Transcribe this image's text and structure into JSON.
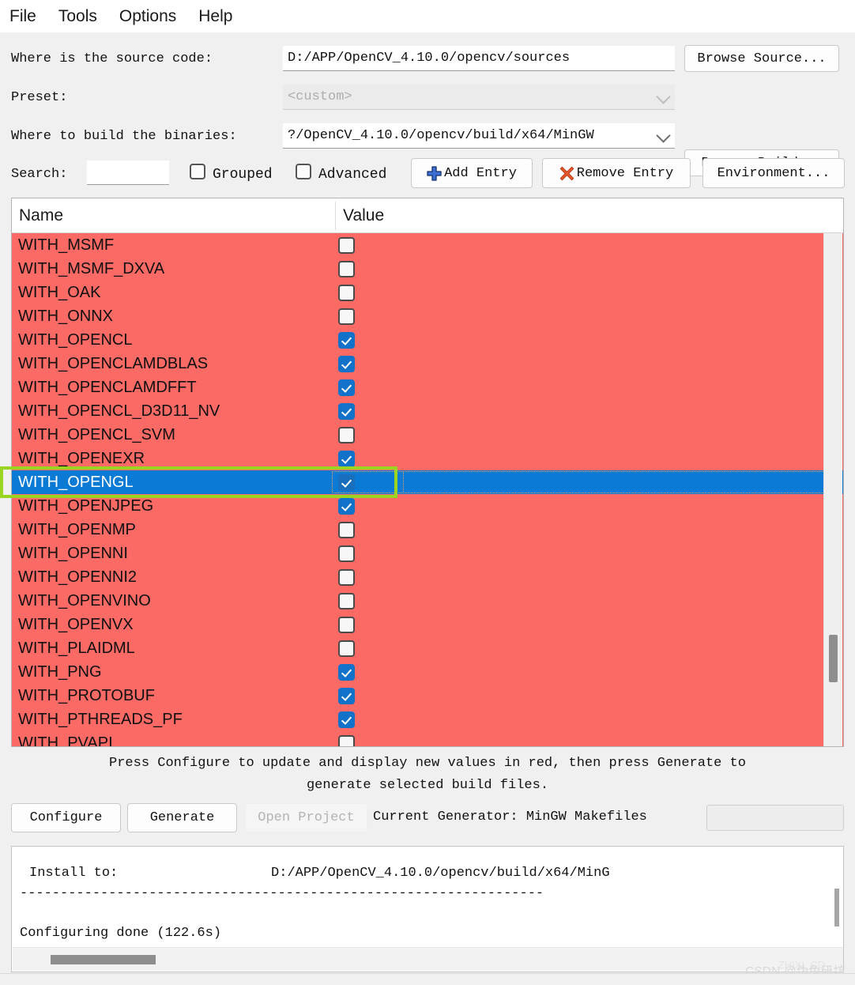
{
  "menubar": {
    "items": [
      {
        "label": "File"
      },
      {
        "label": "Tools"
      },
      {
        "label": "Options"
      },
      {
        "label": "Help"
      }
    ]
  },
  "form": {
    "source_label": "Where is the source code:",
    "source_value": "D:/APP/OpenCV_4.10.0/opencv/sources",
    "browse_source_label": "Browse Source...",
    "preset_label": "Preset:",
    "preset_value": "<custom>",
    "build_label": "Where to build the binaries:",
    "build_value": "?/OpenCV_4.10.0/opencv/build/x64/MinGW",
    "browse_build_label": "Browse Build..."
  },
  "toolbar": {
    "search_label": "Search:",
    "search_value": "",
    "search_placeholder": "",
    "grouped_label": "Grouped",
    "grouped_checked": false,
    "advanced_label": "Advanced",
    "advanced_checked": false,
    "add_entry_label": "Add Entry",
    "remove_entry_label": "Remove Entry",
    "environment_label": "Environment..."
  },
  "table": {
    "columns": [
      "Name",
      "Value"
    ],
    "row_background_color": "#fb6a65",
    "selection_color": "#0b7ad4",
    "highlight_box_color": "#9ad522",
    "rows": [
      {
        "name": "WITH_MSMF",
        "checked": false,
        "selected": false
      },
      {
        "name": "WITH_MSMF_DXVA",
        "checked": false,
        "selected": false
      },
      {
        "name": "WITH_OAK",
        "checked": false,
        "selected": false
      },
      {
        "name": "WITH_ONNX",
        "checked": false,
        "selected": false
      },
      {
        "name": "WITH_OPENCL",
        "checked": true,
        "selected": false
      },
      {
        "name": "WITH_OPENCLAMDBLAS",
        "checked": true,
        "selected": false
      },
      {
        "name": "WITH_OPENCLAMDFFT",
        "checked": true,
        "selected": false
      },
      {
        "name": "WITH_OPENCL_D3D11_NV",
        "checked": true,
        "selected": false
      },
      {
        "name": "WITH_OPENCL_SVM",
        "checked": false,
        "selected": false
      },
      {
        "name": "WITH_OPENEXR",
        "checked": true,
        "selected": false
      },
      {
        "name": "WITH_OPENGL",
        "checked": true,
        "selected": true
      },
      {
        "name": "WITH_OPENJPEG",
        "checked": true,
        "selected": false
      },
      {
        "name": "WITH_OPENMP",
        "checked": false,
        "selected": false
      },
      {
        "name": "WITH_OPENNI",
        "checked": false,
        "selected": false
      },
      {
        "name": "WITH_OPENNI2",
        "checked": false,
        "selected": false
      },
      {
        "name": "WITH_OPENVINO",
        "checked": false,
        "selected": false
      },
      {
        "name": "WITH_OPENVX",
        "checked": false,
        "selected": false
      },
      {
        "name": "WITH_PLAIDML",
        "checked": false,
        "selected": false
      },
      {
        "name": "WITH_PNG",
        "checked": true,
        "selected": false
      },
      {
        "name": "WITH_PROTOBUF",
        "checked": true,
        "selected": false
      },
      {
        "name": "WITH_PTHREADS_PF",
        "checked": true,
        "selected": false
      },
      {
        "name": "WITH_PVAPI",
        "checked": false,
        "selected": false
      }
    ]
  },
  "hint": {
    "line1": "Press Configure to update and display new values in red, then press Generate to",
    "line2": "generate selected build files."
  },
  "actions": {
    "configure_label": "Configure",
    "generate_label": "Generate",
    "open_project_label": "Open Project",
    "current_generator_label": "Current Generator: MinGW Makefiles",
    "progress_value": ""
  },
  "log": {
    "line1": "Install to:                   D:/APP/OpenCV_4.10.0/opencv/build/x64/MinG",
    "line2": "-----------------------------------------------------------------",
    "line3": "Configuring done (122.6s)"
  },
  "watermark": {
    "text": "CSDN @伪兔研坊",
    "text2": "ZHIXI_CD"
  }
}
